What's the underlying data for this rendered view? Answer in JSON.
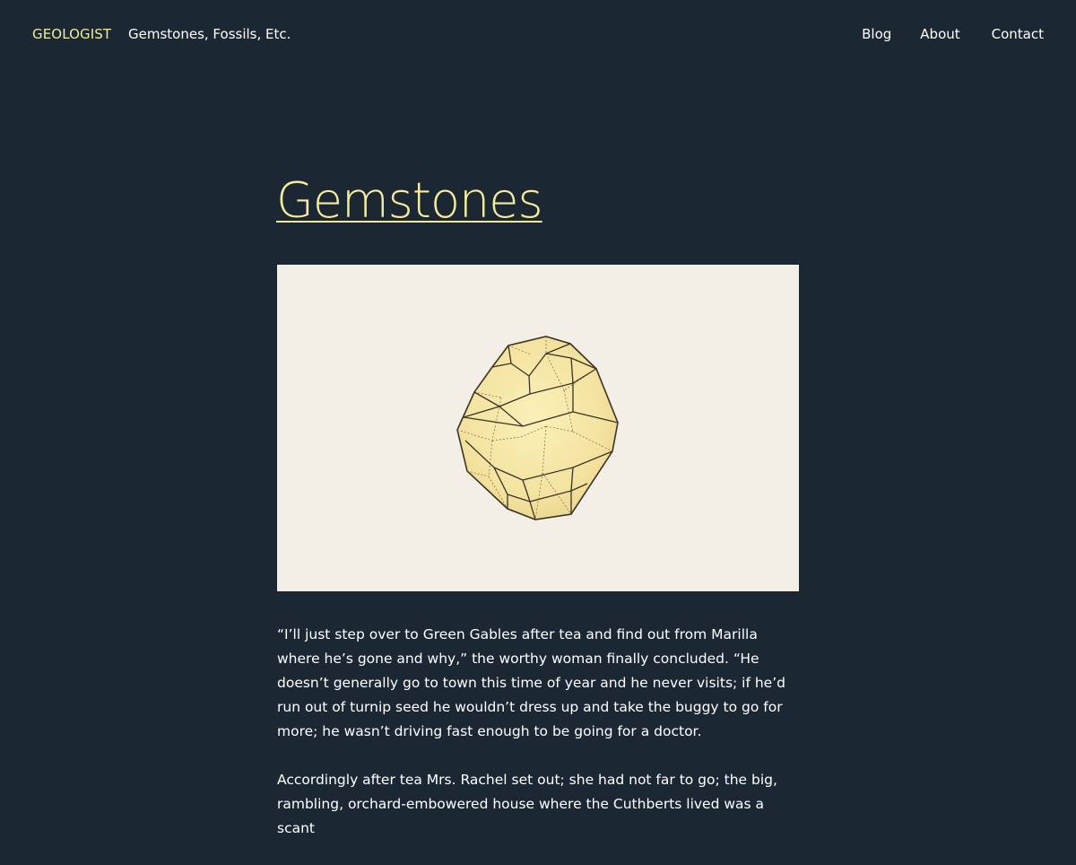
{
  "header": {
    "brand": "GEOLOGIST",
    "tagline": "Gemstones, Fossils, Etc.",
    "nav": [
      {
        "label": "Blog"
      },
      {
        "label": "About"
      },
      {
        "label": "Contact"
      }
    ]
  },
  "main": {
    "title": "Gemstones",
    "paragraphs": [
      "“I’ll just step over to Green Gables after tea and find out from Marilla where he’s gone and why,” the worthy woman finally concluded. “He doesn’t generally go to town this time of year and he never visits; if he’d run out of turnip seed he wouldn’t dress up and take the buggy to go for more; he wasn’t driving fast enough to be going for a doctor.",
      "Accordingly after tea Mrs. Rachel set out; she had not far to go; the big, rambling, orchard-embowered house where the Cuthberts lived was a scant"
    ]
  },
  "colors": {
    "background": "#1b2733",
    "accent": "#f5ec9c",
    "image_background": "#f3efe6",
    "text": "#ffffff"
  }
}
